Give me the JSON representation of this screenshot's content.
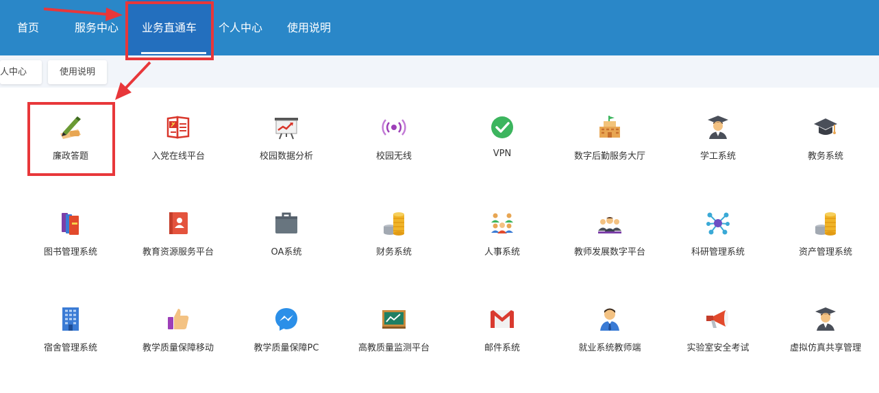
{
  "topnav": {
    "items": [
      {
        "label": "首页"
      },
      {
        "label": "服务中心"
      },
      {
        "label": "业务直通车"
      },
      {
        "label": "个人中心"
      },
      {
        "label": "使用说明"
      }
    ]
  },
  "subbar": {
    "chips": [
      {
        "label": "个人中心"
      },
      {
        "label": "使用说明"
      }
    ]
  },
  "colors": {
    "nav_background": "#2a87c8",
    "nav_active": "#236fbe",
    "annotation_red": "#e8373a"
  },
  "apps": [
    [
      {
        "label": "廉政答题",
        "icon": "pen-writing-icon"
      },
      {
        "label": "入党在线平台",
        "icon": "party-book-icon"
      },
      {
        "label": "校园数据分析",
        "icon": "presentation-chart-icon"
      },
      {
        "label": "校园无线",
        "icon": "wireless-signal-icon"
      },
      {
        "label": "VPN",
        "icon": "check-circle-icon"
      },
      {
        "label": "数字后勤服务大厅",
        "icon": "building-icon"
      },
      {
        "label": "学工系统",
        "icon": "graduate-student-icon"
      },
      {
        "label": "教务系统",
        "icon": "graduation-cap-icon"
      }
    ],
    [
      {
        "label": "图书管理系统",
        "icon": "books-icon"
      },
      {
        "label": "教育资源服务平台",
        "icon": "contact-book-icon"
      },
      {
        "label": "OA系统",
        "icon": "briefcase-icon"
      },
      {
        "label": "财务系统",
        "icon": "coins-icon"
      },
      {
        "label": "人事系统",
        "icon": "people-group-icon"
      },
      {
        "label": "教师发展数字平台",
        "icon": "teachers-group-icon"
      },
      {
        "label": "科研管理系统",
        "icon": "molecule-icon"
      },
      {
        "label": "资产管理系统",
        "icon": "coins-stack-icon"
      }
    ],
    [
      {
        "label": "宿舍管理系统",
        "icon": "dormitory-building-icon"
      },
      {
        "label": "教学质量保障移动",
        "icon": "thumbs-up-icon"
      },
      {
        "label": "教学质量保障PC",
        "icon": "messenger-icon"
      },
      {
        "label": "高教质量监测平台",
        "icon": "chalkboard-chart-icon"
      },
      {
        "label": "邮件系统",
        "icon": "mail-icon"
      },
      {
        "label": "就业系统教师端",
        "icon": "businessman-icon"
      },
      {
        "label": "实验室安全考试",
        "icon": "megaphone-icon"
      },
      {
        "label": "虚拟仿真共享管理",
        "icon": "graduate-student-icon"
      }
    ]
  ]
}
